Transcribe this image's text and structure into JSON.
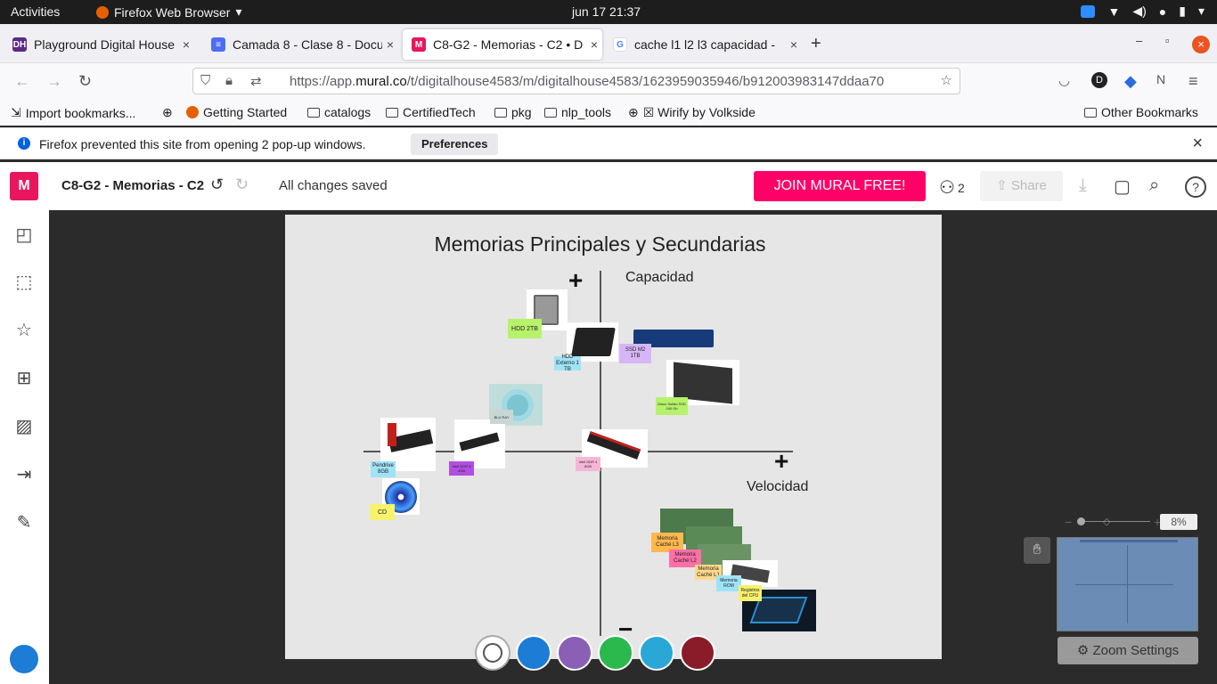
{
  "gnome": {
    "activities": "Activities",
    "app": "Firefox Web Browser",
    "clock": "jun 17  21:37"
  },
  "tabs": [
    {
      "title": "Playground Digital House",
      "color": "#5b2a86",
      "letter": "DH"
    },
    {
      "title": "Camada 8 - Clase 8 - Docu",
      "color": "#4c6ef5",
      "letter": "≡"
    },
    {
      "title": "C8-G2 - Memorias - C2 • D",
      "color": "#e8175d",
      "letter": "M"
    },
    {
      "title": "cache l1 l2 l3 capacidad - ",
      "color": "#ffffff",
      "letter": "G"
    }
  ],
  "url": {
    "prefix": "https://app.",
    "domain": "mural.co",
    "rest": "/t/digitalhouse4583/m/digitalhouse4583/1623959035946/b912003983147ddaa70"
  },
  "bookmarks": [
    "Import bookmarks...",
    "Getting Started",
    "catalogs",
    "CertifiedTech",
    "pkg",
    "nlp_tools",
    "☒ Wirify by Volkside",
    "Other Bookmarks"
  ],
  "notification": {
    "message": "Firefox prevented this site from opening 2 pop-up windows.",
    "button": "Preferences"
  },
  "mural": {
    "title": "C8-G2 - Memorias - C2",
    "saved": "All changes saved",
    "join": "JOIN MURAL FREE!",
    "users": "2",
    "share": "Share",
    "zoom": "8%",
    "zoom_settings": "Zoom Settings",
    "logo": "M"
  },
  "board": {
    "title": "Memorias Principales y Secundarias",
    "y_label": "Capacidad",
    "x_label": "Velocidad",
    "plus_top": "+",
    "plus_right": "+",
    "minus_bottom": "−",
    "stickies": [
      {
        "text": "HDD 2TB",
        "color": "#b6f26b"
      },
      {
        "text": "HDD Externo 1 TB",
        "color": "#9ee3f7"
      },
      {
        "text": "SSD M2 1TB",
        "color": "#d7b6f7"
      },
      {
        "text": "Disco Solido SSD 240 Gb",
        "color": "#b6f26b"
      },
      {
        "text": "BLU RAY",
        "color": "#c9d6d6"
      },
      {
        "text": "Pendrive 8GB",
        "color": "#9ee3f7"
      },
      {
        "text": "Intel DDR 3 4GB",
        "color": "#b14fe0"
      },
      {
        "text": "Intel DDR 4 8GB",
        "color": "#f7b6d7"
      },
      {
        "text": "CD",
        "color": "#f7f26b"
      },
      {
        "text": "Memoria Caché L3",
        "color": "#ffb84d"
      },
      {
        "text": "Memoria Caché L2",
        "color": "#ff6fa8"
      },
      {
        "text": "Memoria Caché L1",
        "color": "#ffd98a"
      },
      {
        "text": "Memoria ROM",
        "color": "#9ee3f7"
      },
      {
        "text": "Registros del CPU",
        "color": "#f7f26b"
      }
    ]
  }
}
